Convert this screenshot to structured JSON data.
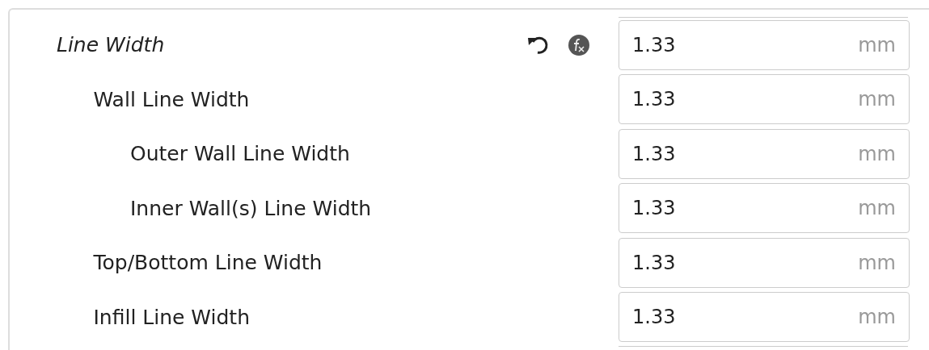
{
  "settings": [
    {
      "label": "Line Width",
      "calculated": true,
      "has_reset": true,
      "has_formula": true,
      "value": "1.33",
      "unit": "mm",
      "children": [
        {
          "label": "Wall Line Width",
          "calculated": false,
          "has_reset": false,
          "has_formula": false,
          "value": "1.33",
          "unit": "mm",
          "children": [
            {
              "label": "Outer Wall Line Width",
              "calculated": false,
              "has_reset": false,
              "has_formula": false,
              "value": "1.33",
              "unit": "mm"
            },
            {
              "label": "Inner Wall(s) Line Width",
              "calculated": false,
              "has_reset": false,
              "has_formula": false,
              "value": "1.33",
              "unit": "mm"
            }
          ]
        },
        {
          "label": "Top/Bottom Line Width",
          "calculated": false,
          "has_reset": false,
          "has_formula": false,
          "value": "1.33",
          "unit": "mm"
        },
        {
          "label": "Infill Line Width",
          "calculated": false,
          "has_reset": false,
          "has_formula": false,
          "value": "1.33",
          "unit": "mm"
        }
      ]
    }
  ]
}
